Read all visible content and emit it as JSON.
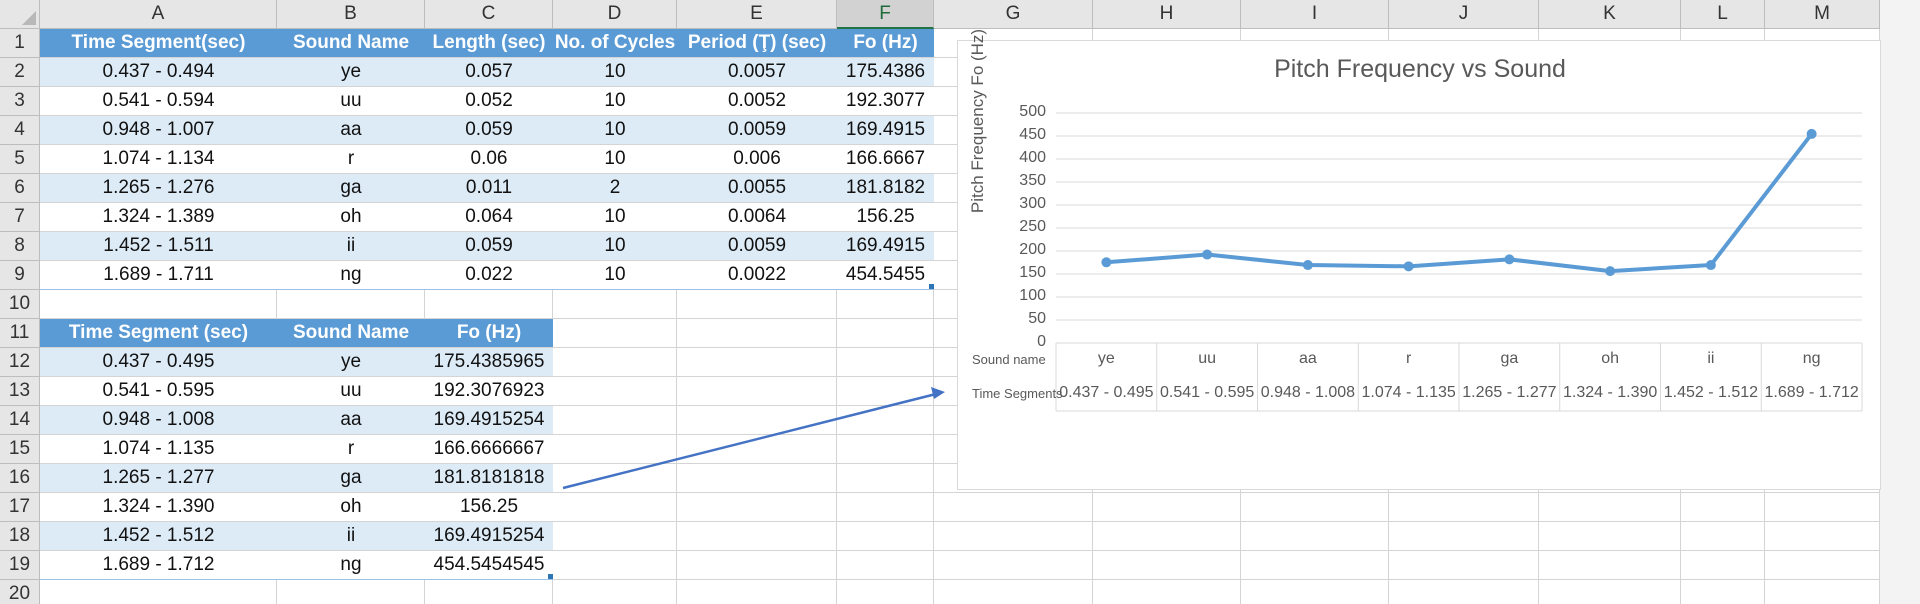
{
  "columns": [
    "A",
    "B",
    "C",
    "D",
    "E",
    "F",
    "G",
    "H",
    "I",
    "J",
    "K",
    "L",
    "M"
  ],
  "selected_column": "F",
  "rows": [
    "1",
    "2",
    "3",
    "4",
    "5",
    "6",
    "7",
    "8",
    "9",
    "10",
    "11",
    "12",
    "13",
    "14",
    "15",
    "16",
    "17",
    "18",
    "19",
    "20"
  ],
  "table1": {
    "headers": [
      "Time Segment(sec)",
      "Sound Name",
      "Length (sec)",
      "No. of Cycles",
      "Period (Ţ) (sec)",
      "Fo (Hz)"
    ],
    "rows": [
      [
        "0.437 - 0.494",
        "ye",
        "0.057",
        "10",
        "0.0057",
        "175.4386"
      ],
      [
        "0.541 - 0.594",
        "uu",
        "0.052",
        "10",
        "0.0052",
        "192.3077"
      ],
      [
        "0.948 - 1.007",
        "aa",
        "0.059",
        "10",
        "0.0059",
        "169.4915"
      ],
      [
        "1.074 - 1.134",
        "r",
        "0.06",
        "10",
        "0.006",
        "166.6667"
      ],
      [
        "1.265 - 1.276",
        "ga",
        "0.011",
        "2",
        "0.0055",
        "181.8182"
      ],
      [
        "1.324 - 1.389",
        "oh",
        "0.064",
        "10",
        "0.0064",
        "156.25"
      ],
      [
        "1.452 - 1.511",
        "ii",
        "0.059",
        "10",
        "0.0059",
        "169.4915"
      ],
      [
        "1.689 - 1.711",
        "ng",
        "0.022",
        "10",
        "0.0022",
        "454.5455"
      ]
    ]
  },
  "table2": {
    "headers": [
      "Time Segment (sec)",
      "Sound Name",
      "Fo (Hz)"
    ],
    "rows": [
      [
        "0.437 - 0.495",
        "ye",
        "175.4385965"
      ],
      [
        "0.541 - 0.595",
        "uu",
        "192.3076923"
      ],
      [
        "0.948 - 1.008",
        "aa",
        "169.4915254"
      ],
      [
        "1.074 - 1.135",
        "r",
        "166.6666667"
      ],
      [
        "1.265 - 1.277",
        "ga",
        "181.8181818"
      ],
      [
        "1.324 - 1.390",
        "oh",
        "156.25"
      ],
      [
        "1.452 - 1.512",
        "ii",
        "169.4915254"
      ],
      [
        "1.689 - 1.712",
        "ng",
        "454.5454545"
      ]
    ]
  },
  "chart_data": {
    "type": "line",
    "title": "Pitch Frequency vs Sound",
    "ylabel": "Pitch Frequency Fo (Hz)",
    "ylim": [
      0,
      500
    ],
    "yticks": [
      "0",
      "50",
      "100",
      "150",
      "200",
      "250",
      "300",
      "350",
      "400",
      "450",
      "500"
    ],
    "grid": true,
    "axis_rows": [
      {
        "name": "Sound name",
        "labels": [
          "ye",
          "uu",
          "aa",
          "r",
          "ga",
          "oh",
          "ii",
          "ng"
        ]
      },
      {
        "name": "Time Segments",
        "labels": [
          "0.437 - 0.495",
          "0.541 - 0.595",
          "0.948 - 1.008",
          "1.074 - 1.135",
          "1.265 - 1.277",
          "1.324 - 1.390",
          "1.452 - 1.512",
          "1.689 - 1.712"
        ]
      }
    ],
    "series": [
      {
        "values": [
          175.4386,
          192.3077,
          169.4915,
          166.6667,
          181.8182,
          156.25,
          169.4915,
          454.5455
        ]
      }
    ],
    "line_color": "#5b9bd5"
  }
}
